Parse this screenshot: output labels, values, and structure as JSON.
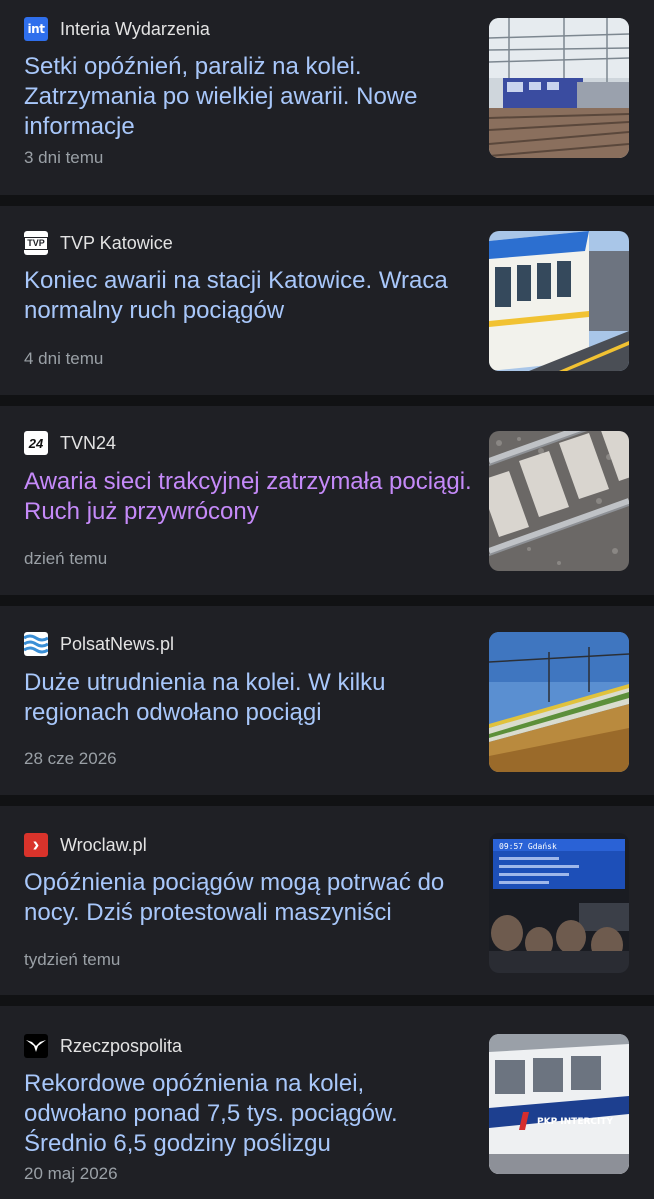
{
  "articles": [
    {
      "source": "Interia Wydarzenia",
      "headline": "Setki opóźnień, paraliż na kolei. Zatrzymania po wielkiej awarii. Nowe informacje",
      "time": "3 dni temu",
      "favicon_icon": "interia-logo-icon",
      "favicon_text": "int",
      "favicon_color": "#2f6fec",
      "thumbnail": "train-overhead-lines-thumbnail"
    },
    {
      "source": "TVP Katowice",
      "headline": "Koniec awarii na stacji Katowice. Wraca normalny ruch pociągów",
      "time": "4 dni temu",
      "favicon_icon": "tvp-logo-icon",
      "favicon_text": "TVP",
      "favicon_color": "#ffffff",
      "thumbnail": "train-platform-thumbnail"
    },
    {
      "source": "TVN24",
      "headline": "Awaria sieci trakcyjnej zatrzymała pociągi. Ruch już przywrócony",
      "time": "dzień temu",
      "favicon_icon": "tvn24-logo-icon",
      "favicon_text": "24",
      "favicon_color": "#ffffff",
      "thumbnail": "railway-tracks-thumbnail",
      "visited": true
    },
    {
      "source": "PolsatNews.pl",
      "headline": "Duże utrudnienia na kolei. W kilku regionach odwołano pociągi",
      "time": "28 cze 2026",
      "favicon_icon": "polsatnews-logo-icon",
      "favicon_color": "#3a8fd6",
      "thumbnail": "train-field-sunset-thumbnail"
    },
    {
      "source": "Wroclaw.pl",
      "headline": "Opóźnienia pociągów mogą potrwać do nocy. Dziś protestowali maszyniści",
      "time": "tydzień temu",
      "favicon_icon": "wroclaw-logo-icon",
      "favicon_text": "›",
      "favicon_color": "#d9332b",
      "thumbnail": "departure-board-crowd-thumbnail",
      "thumbnail_board_text": "09:57 Gdańsk"
    },
    {
      "source": "Rzeczpospolita",
      "headline": "Rekordowe opóźnienia na kolei, odwołano ponad 7,5 tys. pociągów. Średnio 6,5 godziny poślizgu",
      "time": "20 maj 2026",
      "favicon_icon": "rzeczpospolita-eagle-icon",
      "favicon_color": "#000000",
      "thumbnail": "pkp-intercity-train-thumbnail",
      "thumbnail_train_text": "PKP INTERCITY"
    }
  ],
  "colors": {
    "background": "#111214",
    "card": "#1f2025",
    "headline": "#a8c7fa",
    "headline_visited": "#c58af9",
    "source_text": "#e3e3e3",
    "meta_text": "#9aa0a6"
  }
}
